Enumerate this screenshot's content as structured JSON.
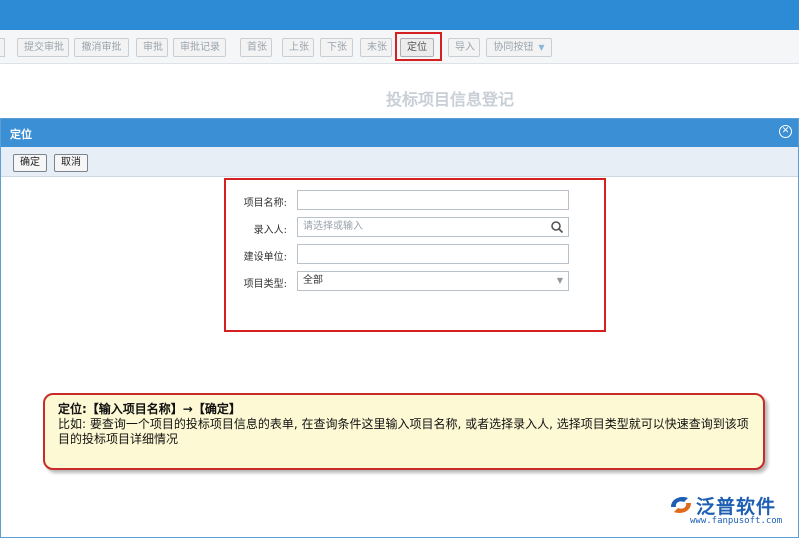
{
  "toolbar": {
    "buttons": [
      {
        "label": "提交审批"
      },
      {
        "label": "撤消审批"
      },
      {
        "label": "审批"
      },
      {
        "label": "审批记录"
      },
      {
        "label": "首张"
      },
      {
        "label": "上张"
      },
      {
        "label": "下张"
      },
      {
        "label": "末张"
      },
      {
        "label": "定位"
      },
      {
        "label": "导入"
      },
      {
        "label": "协同按钮"
      }
    ]
  },
  "page": {
    "title": "投标项目信息登记"
  },
  "dialog": {
    "title": "定位",
    "close_icon": "close-circle-icon",
    "confirm_label": "确定",
    "cancel_label": "取消",
    "fields": {
      "project_name": {
        "label": "项目名称:",
        "value": ""
      },
      "entered_by": {
        "label": "录入人:",
        "placeholder": "请选择或输入",
        "icon": "search-icon"
      },
      "construction_unit": {
        "label": "建设单位:",
        "value": ""
      },
      "project_type": {
        "label": "项目类型:",
        "value": "全部",
        "icon": "chevron-down-icon"
      }
    }
  },
  "callout": {
    "line1": "定位:【输入项目名称】→【确定】",
    "line2": "比如: 要查询一个项目的投标项目信息的表单, 在查询条件这里输入项目名称, 或者选择录入人, 选择项目类型就可以快速查询到该项目的投标项目详细情况"
  },
  "logo": {
    "name": "泛普软件",
    "url": "www.fanpusoft.com"
  },
  "colors": {
    "accent": "#3b8fd4",
    "highlight": "#d42020",
    "callout_bg": "#fdf9d4",
    "logo": "#1e5fb3"
  }
}
